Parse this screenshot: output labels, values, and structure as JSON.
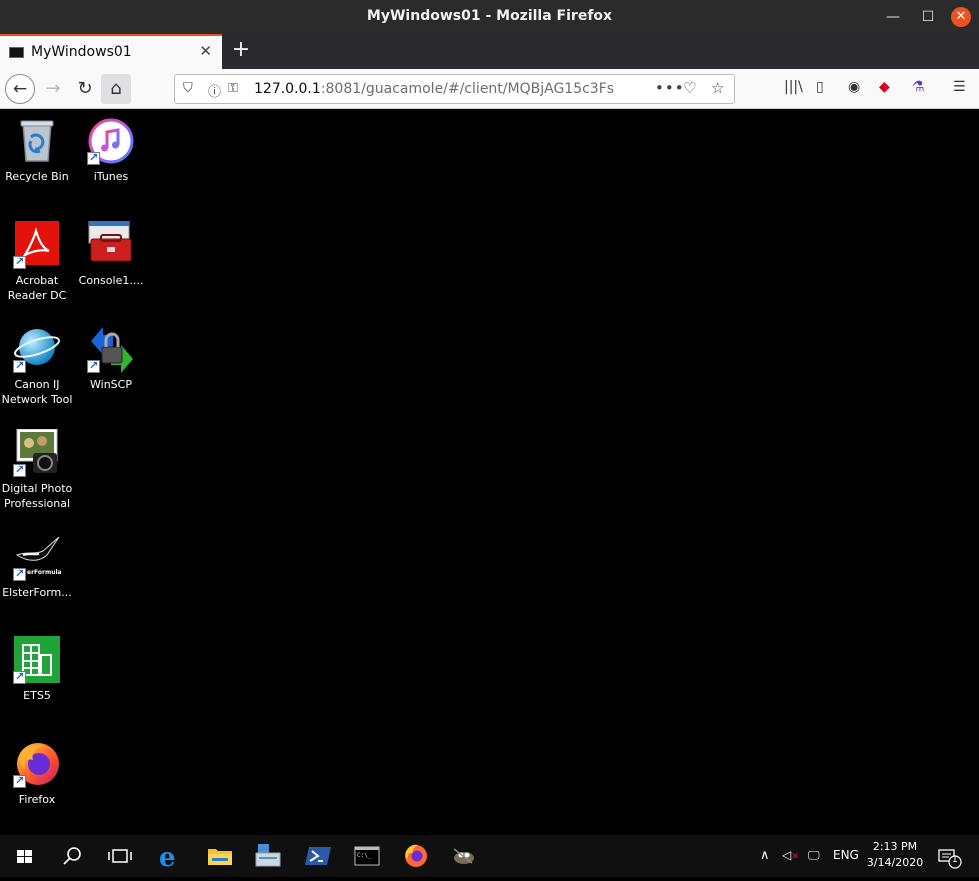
{
  "window": {
    "title": "MyWindows01 - Mozilla Firefox"
  },
  "tab": {
    "label": "MyWindows01"
  },
  "address": {
    "host": "127.0.0.1",
    "rest": ":8081/guacamole/#/client/MQBjAG15c3Fs"
  },
  "desktop_icons": [
    {
      "label": "Recycle Bin",
      "icon": "recycle-bin-icon"
    },
    {
      "label": "iTunes",
      "icon": "itunes-icon"
    },
    {
      "label": "Acrobat Reader DC",
      "icon": "acrobat-icon"
    },
    {
      "label": "Console1....",
      "icon": "toolbox-icon"
    },
    {
      "label": "Canon IJ Network Tool",
      "icon": "globe-icon"
    },
    {
      "label": "WinSCP",
      "icon": "winscp-icon"
    },
    {
      "label": "Digital Photo Professional",
      "icon": "camera-photo-icon"
    },
    {
      "label": "ElsterForm...",
      "icon": "magpie-icon"
    },
    {
      "label": "ETS5",
      "icon": "ets5-icon"
    },
    {
      "label": "Firefox",
      "icon": "firefox-icon"
    }
  ],
  "elster_badge_text": "erFormular",
  "tray": {
    "language": "ENG",
    "time": "2:13 PM",
    "date": "3/14/2020",
    "notification_count": "1"
  }
}
